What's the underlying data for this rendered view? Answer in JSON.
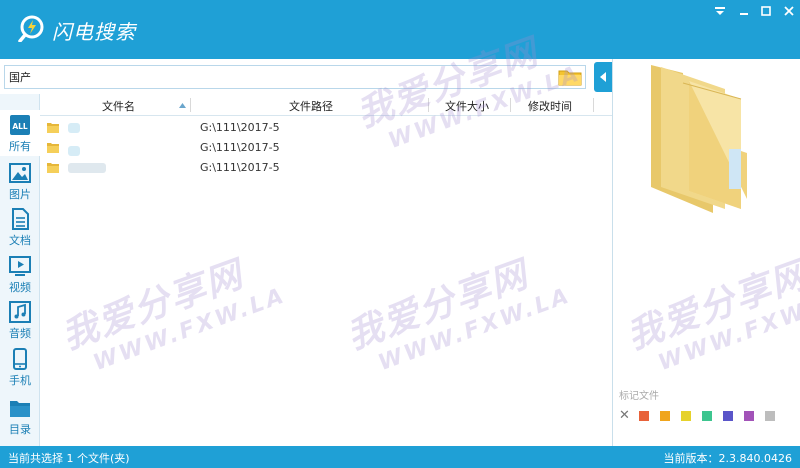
{
  "app": {
    "title": "闪电搜索"
  },
  "search": {
    "value": "国产"
  },
  "nav": [
    {
      "label": "所有",
      "icon": "all-icon"
    },
    {
      "label": "图片",
      "icon": "picture-icon"
    },
    {
      "label": "文档",
      "icon": "document-icon"
    },
    {
      "label": "视频",
      "icon": "video-icon"
    },
    {
      "label": "音频",
      "icon": "audio-icon"
    },
    {
      "label": "手机",
      "icon": "phone-icon"
    },
    {
      "label": "目录",
      "icon": "folder-icon"
    }
  ],
  "table": {
    "columns": [
      "文件名",
      "文件路径",
      "文件大小",
      "修改时间"
    ],
    "rows": [
      {
        "path": "G:\\111\\2017-5"
      },
      {
        "path": "G:\\111\\2017-5"
      },
      {
        "path": "G:\\111\\2017-5"
      }
    ]
  },
  "preview": {
    "tag_label": "标记文件",
    "tag_colors": [
      "#e8623a",
      "#f0a51c",
      "#e6d22b",
      "#3dc58f",
      "#5a55c9",
      "#a253b8",
      "#bdbdbd"
    ]
  },
  "status": {
    "left": "当前共选择 1 个文件(夹)",
    "right": "当前版本：2.3.840.0426"
  },
  "watermark": {
    "main": "我爱分享网",
    "sub": "WWW.FXW.LA"
  },
  "colors": {
    "accent": "#1fa0d6"
  }
}
